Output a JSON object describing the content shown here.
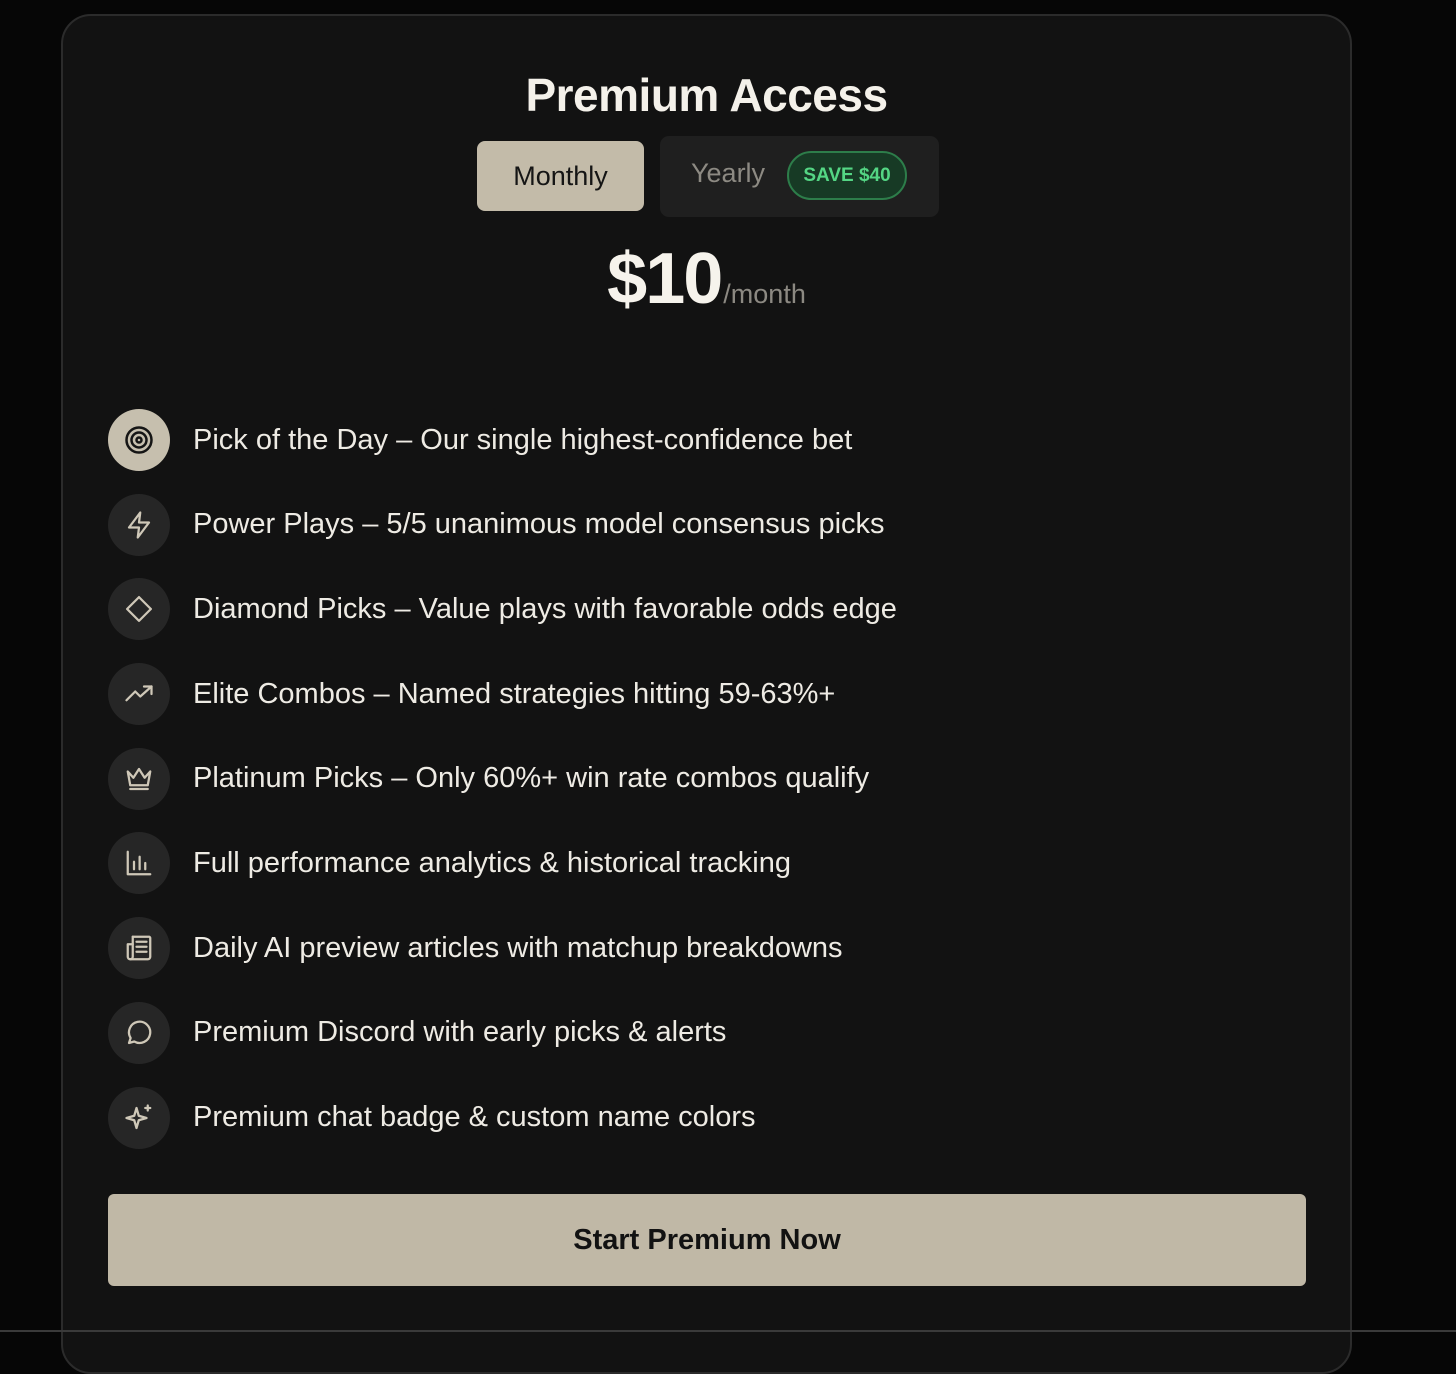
{
  "card": {
    "title": "Premium Access",
    "billing": {
      "monthly_label": "Monthly",
      "yearly_label": "Yearly",
      "save_badge": "SAVE $40",
      "selected": "Monthly"
    },
    "price": {
      "amount": "$10",
      "period": "/month"
    },
    "features": [
      {
        "icon": "target-icon",
        "label": "Pick of the Day – Our single highest-confidence bet"
      },
      {
        "icon": "lightning-icon",
        "label": "Power Plays – 5/5 unanimous model consensus picks"
      },
      {
        "icon": "diamond-icon",
        "label": "Diamond Picks – Value plays with favorable odds edge"
      },
      {
        "icon": "trending-up-icon",
        "label": "Elite Combos – Named strategies hitting 59-63%+"
      },
      {
        "icon": "crown-icon",
        "label": "Platinum Picks – Only 60%+ win rate combos qualify"
      },
      {
        "icon": "bar-chart-icon",
        "label": "Full performance analytics & historical tracking"
      },
      {
        "icon": "newspaper-icon",
        "label": "Daily AI preview articles with matchup breakdowns"
      },
      {
        "icon": "message-circle-icon",
        "label": "Premium Discord with early picks & alerts"
      },
      {
        "icon": "sparkles-icon",
        "label": "Premium chat badge & custom name colors"
      }
    ],
    "cta_label": "Start Premium Now"
  },
  "colors": {
    "background": "#060606",
    "card": "#121212",
    "accent": "#c3bba9",
    "badge_green": "#54d684"
  }
}
